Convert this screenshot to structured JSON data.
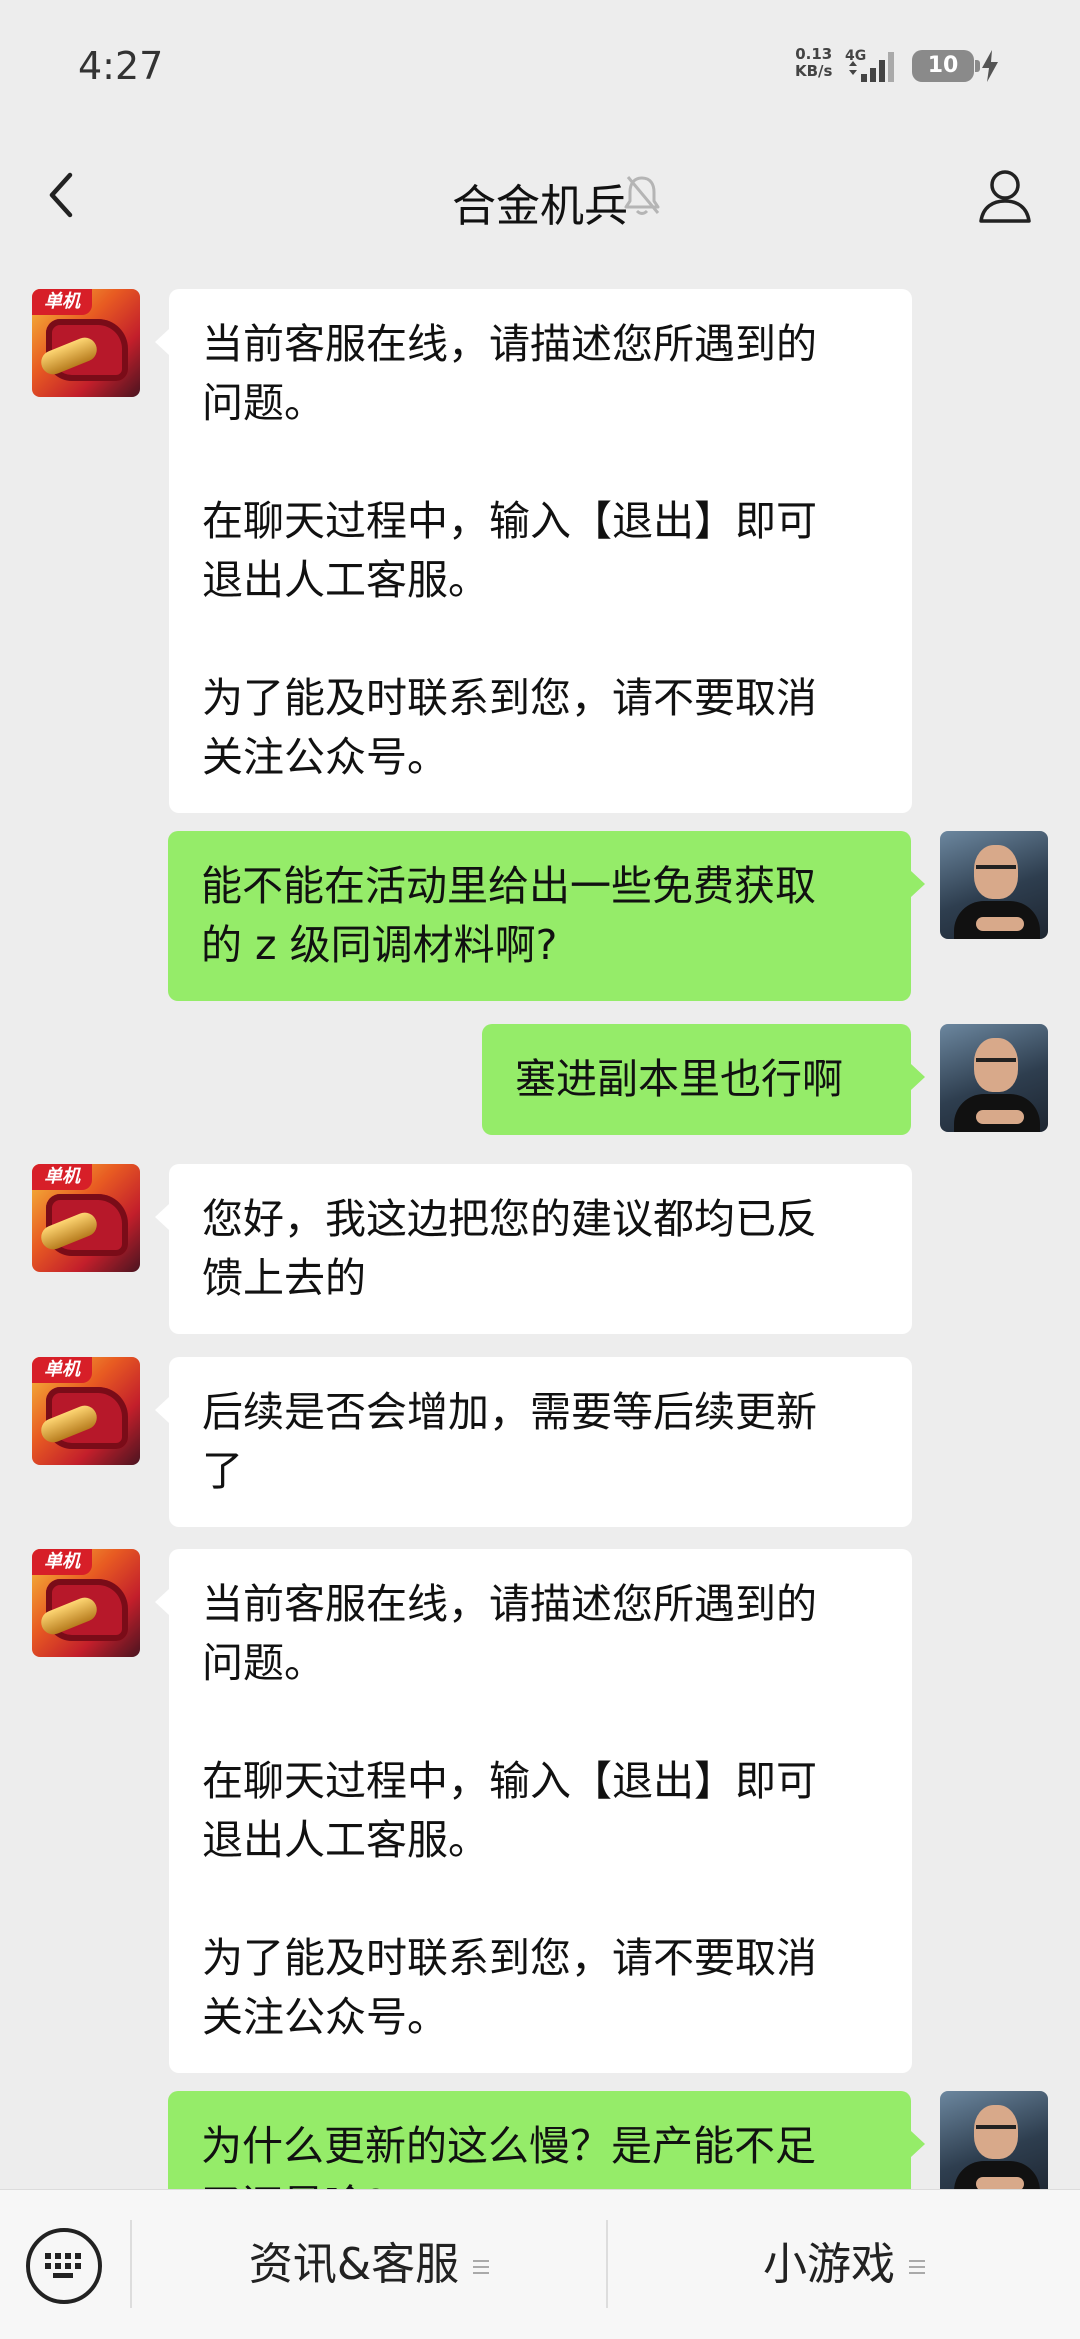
{
  "status_bar": {
    "time": "4:27",
    "net_speed_value": "0.13",
    "net_speed_unit": "KB/s",
    "network_type": "4G",
    "battery_level": "10",
    "icons": [
      "signal-icon",
      "battery-icon",
      "charging-bolt-icon"
    ]
  },
  "header": {
    "title": "合金机兵",
    "icons": [
      "back-icon",
      "mute-bell-icon",
      "profile-icon"
    ]
  },
  "messages": [
    {
      "from": "official",
      "text": "当前客服在线，请描述您所遇到的\n问题。\n\n在聊天过程中，输入【退出】即可\n退出人工客服。\n\n为了能及时联系到您，请不要取消\n关注公众号。"
    },
    {
      "from": "user",
      "text": "能不能在活动里给出一些免费获取\n的 z 级同调材料啊?"
    },
    {
      "from": "user",
      "text": "塞进副本里也行啊"
    },
    {
      "from": "official",
      "text": "您好，我这边把您的建议都均已反\n馈上去的"
    },
    {
      "from": "official",
      "text": "后续是否会增加，需要等后续更新\n了"
    },
    {
      "from": "official",
      "text": "当前客服在线，请描述您所遇到的\n问题。\n\n在聊天过程中，输入【退出】即可\n退出人工客服。\n\n为了能及时联系到您，请不要取消\n关注公众号。"
    },
    {
      "from": "user",
      "text": "为什么更新的这么慢？是产能不足\n了还是啥?"
    }
  ],
  "avatar_badge": "单机",
  "bottom_menu": {
    "items": [
      {
        "label": "资讯&客服"
      },
      {
        "label": "小游戏"
      }
    ],
    "icons": [
      "keyboard-icon",
      "menu-lines-icon"
    ]
  },
  "colors": {
    "background": "#ededed",
    "incoming_bubble": "#ffffff",
    "outgoing_bubble": "#95ec69",
    "bottom_bar": "#f7f7f7"
  }
}
